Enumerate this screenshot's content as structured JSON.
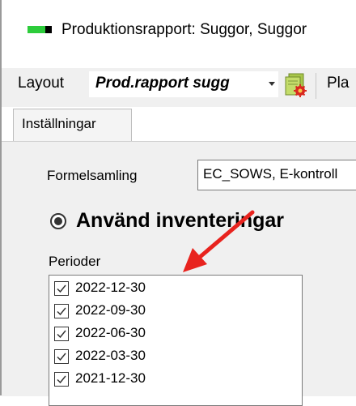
{
  "window": {
    "title": "Produktionsrapport: Suggor, Suggor"
  },
  "toolbar": {
    "layout_label": "Layout",
    "layout_value": "Prod.rapport sugg",
    "next_label": "Pla"
  },
  "tabs": [
    {
      "label": "Inställningar",
      "active": true
    }
  ],
  "settings": {
    "formelsamling_label": "Formelsamling",
    "formelsamling_value": "EC_SOWS, E-kontroll",
    "radio_label": "Använd inventeringar",
    "radio_selected": true,
    "perioder_label": "Perioder",
    "periods": [
      {
        "label": "2022-12-30",
        "checked": true
      },
      {
        "label": "2022-09-30",
        "checked": true
      },
      {
        "label": "2022-06-30",
        "checked": true
      },
      {
        "label": "2022-03-30",
        "checked": true
      },
      {
        "label": "2021-12-30",
        "checked": true
      }
    ]
  },
  "colors": {
    "app_icon_green": "#2dcc3b",
    "annotation_arrow": "#e8231e",
    "panel_bg": "#f0f0f0"
  },
  "icons": {
    "app": "app-green-bar-icon",
    "report": "report-gear-icon",
    "combo": "dropdown-arrow-icon",
    "checkbox": "checkmark-icon",
    "annotation": "red-arrow-annotation"
  }
}
